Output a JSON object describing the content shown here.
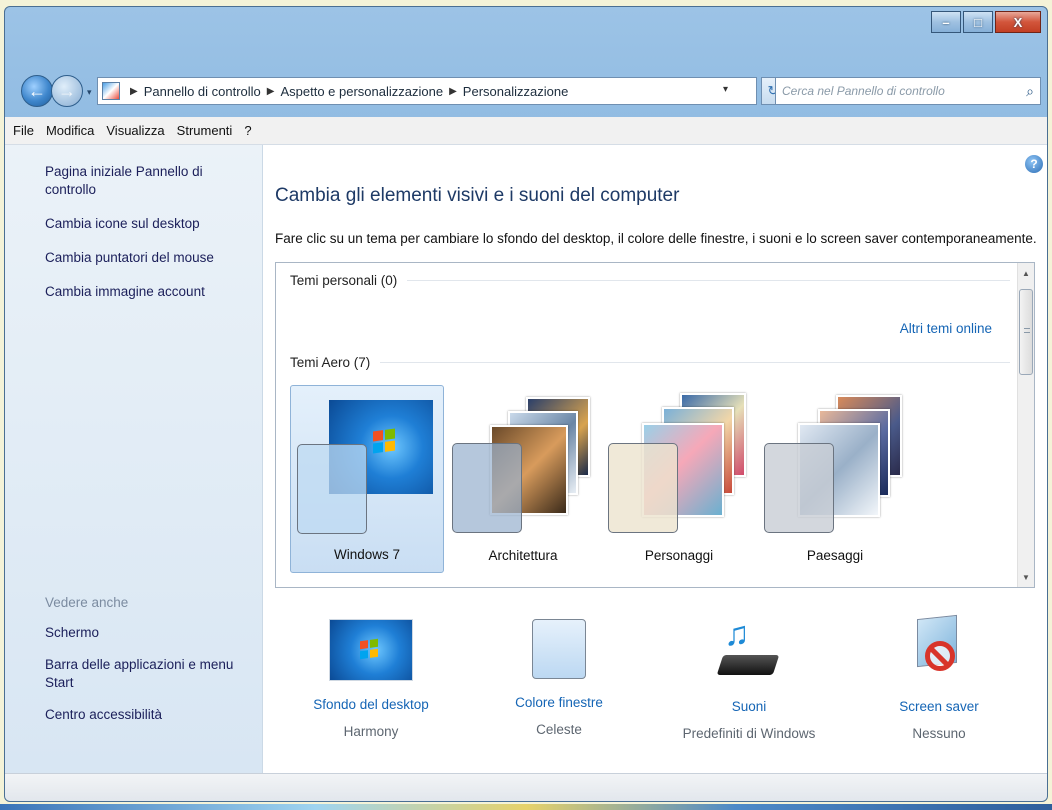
{
  "window": {
    "buttons": {
      "minimize": "–",
      "maximize": "□",
      "close": "X"
    }
  },
  "nav": {
    "back": "←",
    "forward": "→",
    "dropdown": "▾",
    "breadcrumbs": [
      "Pannello di controllo",
      "Aspetto e personalizzazione",
      "Personalizzazione"
    ],
    "address_dropdown": "▾",
    "refresh": "↻",
    "search_placeholder": "Cerca nel Pannello di controllo",
    "search_icon": "⌕"
  },
  "menubar": [
    "File",
    "Modifica",
    "Visualizza",
    "Strumenti",
    "?"
  ],
  "sidebar": {
    "tasks": [
      "Pagina iniziale Pannello di controllo",
      "Cambia icone sul desktop",
      "Cambia puntatori del mouse",
      "Cambia immagine account"
    ],
    "see_also_title": "Vedere anche",
    "see_also": [
      "Schermo",
      "Barra delle applicazioni e menu Start",
      "Centro accessibilità"
    ]
  },
  "content": {
    "help": "?",
    "heading": "Cambia gli elementi visivi e i suoni del computer",
    "description": "Fare clic su un tema per cambiare lo sfondo del desktop, il colore delle finestre, i suoni e lo screen saver contemporaneamente.",
    "groups": {
      "personal": "Temi personali (0)",
      "aero": "Temi Aero (7)"
    },
    "more_themes": "Altri temi online",
    "themes": [
      "Windows 7",
      "Architettura",
      "Personaggi",
      "Paesaggi"
    ],
    "scroll": {
      "up": "▲",
      "down": "▼"
    }
  },
  "bottom": [
    {
      "title": "Sfondo del desktop",
      "subtitle": "Harmony"
    },
    {
      "title": "Colore finestre",
      "subtitle": "Celeste"
    },
    {
      "title": "Suoni",
      "subtitle": "Predefiniti di Windows"
    },
    {
      "title": "Screen saver",
      "subtitle": "Nessuno"
    }
  ],
  "icons": {
    "sound": "♫"
  }
}
